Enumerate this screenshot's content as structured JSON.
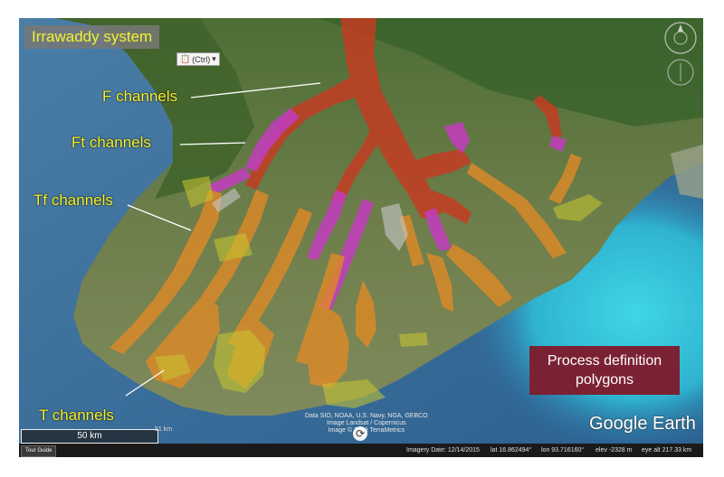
{
  "title": "Irrawaddy system",
  "labels": {
    "f_channels": "F channels",
    "ft_channels": "Ft channels",
    "tf_channels": "Tf channels",
    "t_channels": "T channels"
  },
  "legend_box": {
    "line1": "Process definition",
    "line2": "polygons"
  },
  "ctrl_chip": "(Ctrl)",
  "attribution": {
    "line1": "Data SIO, NOAA, U.S. Navy, NGA, GEBCO",
    "line2": "Image Landsat / Copernicus",
    "line3": "Image © 2018 TerraMetrics"
  },
  "brand": "Google Earth",
  "scale": {
    "label": "50 km",
    "tick": "51 km"
  },
  "status_bar": {
    "tour_guide": "Tour Guide",
    "imagery_date": "Imagery Date: 12/14/2015",
    "lat": "lat   16.862494°",
    "lon": "lon   93.716160°",
    "elev": "elev  -2328 m",
    "eye_alt": "eye alt 217.33 km"
  },
  "icons": {
    "compass": "compass-icon",
    "refresh": "refresh-icon",
    "paste": "clipboard-icon"
  },
  "colors": {
    "f": "#c83a22",
    "ft": "#c43cc0",
    "tf": "#e08a26",
    "t": "#c8c830",
    "legend_bg": "#7a2233",
    "label_text": "#f2f230"
  }
}
